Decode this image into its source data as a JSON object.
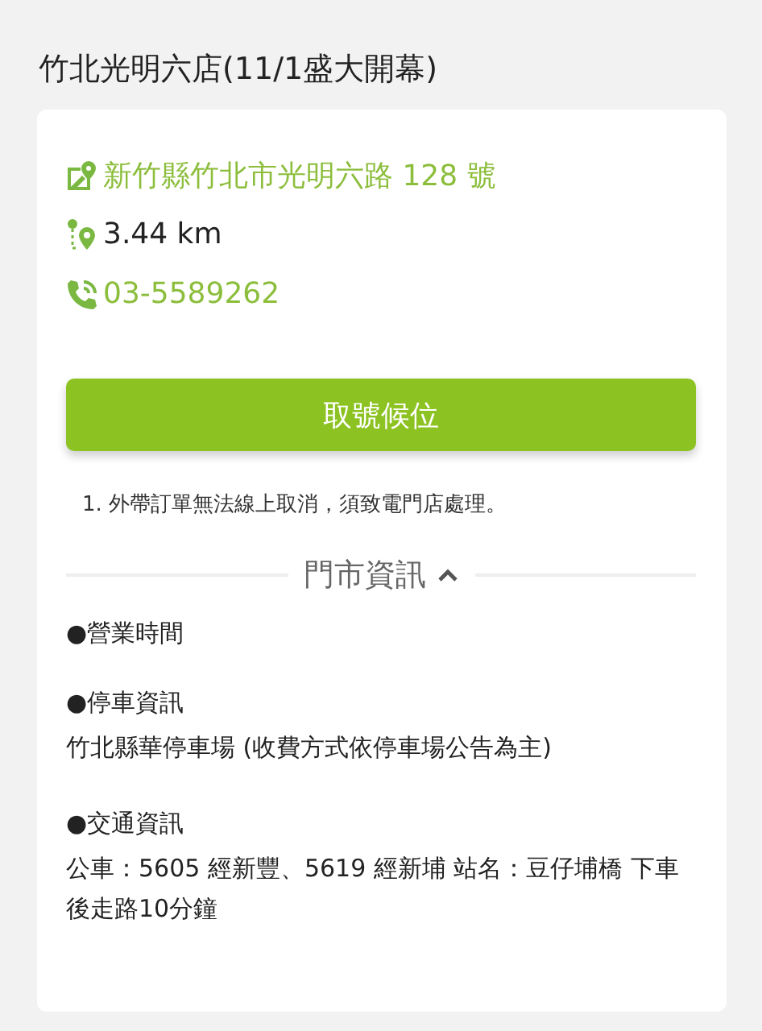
{
  "store_name": "竹北光明六店(11/1盛大開幕)",
  "contacts": [
    {
      "kind": "address",
      "text": "新竹縣竹北市光明六路 128 號"
    },
    {
      "kind": "distance",
      "text": "3.44 km"
    },
    {
      "kind": "phone",
      "text": "03-5589262"
    }
  ],
  "action_button": "取號候位",
  "notes": [
    "1. 外帶訂單無法線上取消，須致電門店處理。"
  ],
  "store_info": {
    "title": "門市資訊",
    "expanded": true,
    "sections": [
      {
        "heading": "●營業時間"
      },
      {
        "heading": "●停車資訊",
        "body": "竹北縣華停車場 (收費方式依停車場公告為主)"
      },
      {
        "heading": "●交通資訊",
        "body": "公車：5605 經新豐、5619 經新埔 站名：豆仔埔橋 下車後走路10分鐘"
      }
    ]
  }
}
